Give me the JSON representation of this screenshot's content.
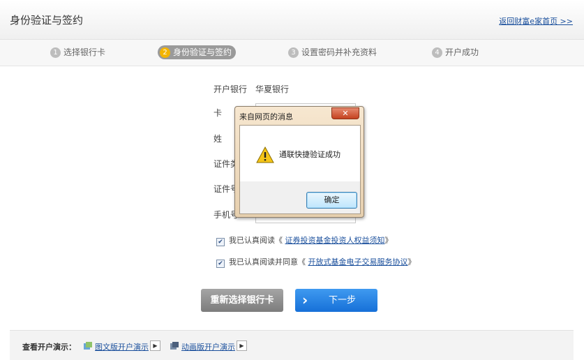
{
  "header": {
    "title": "身份验证与签约",
    "back_link": "返回财富e家首页 >>"
  },
  "steps": [
    {
      "num": "1",
      "label": "选择银行卡",
      "active": false
    },
    {
      "num": "2",
      "label": "身份验证与签约",
      "active": true
    },
    {
      "num": "3",
      "label": "设置密码并补充资料",
      "active": false
    },
    {
      "num": "4",
      "label": "开户成功",
      "active": false
    }
  ],
  "form": {
    "bank_label": "开户银行",
    "bank_value": "华夏银行",
    "card_label": "卡",
    "name_label": "姓",
    "id_type_label": "证件类",
    "id_no_label": "证件号",
    "phone_label": "手机号"
  },
  "agreements": [
    {
      "prefix": "我已认真阅读《",
      "link": "证券投资基金投资人权益须知",
      "suffix": "》",
      "checked": true
    },
    {
      "prefix": "我已认真阅读并同意《",
      "link": "开放式基金电子交易服务协议",
      "suffix": "》",
      "checked": true
    }
  ],
  "buttons": {
    "reselect": "重新选择银行卡",
    "next": "下一步"
  },
  "footer": {
    "label": "查看开户演示：",
    "text_demo": "图文版开户演示",
    "anim_demo": "动画版开户演示"
  },
  "dialog": {
    "title": "来自网页的消息",
    "message": "通联快捷验证成功",
    "ok": "确定",
    "close": "✕"
  }
}
